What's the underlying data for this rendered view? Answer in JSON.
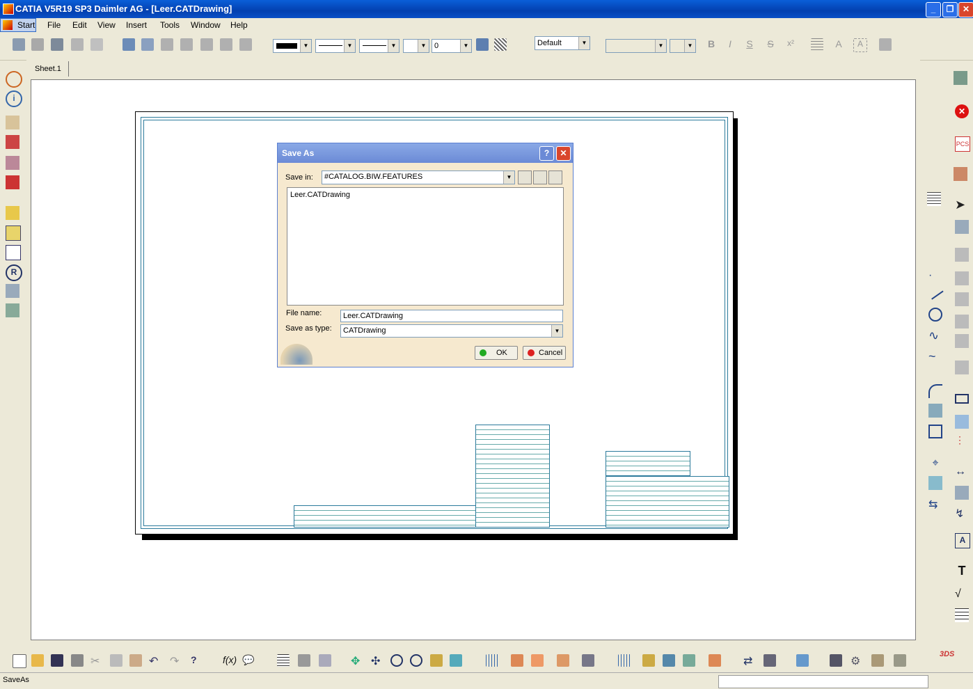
{
  "window": {
    "title": "CATIA V5R19 SP3 Daimler AG - [Leer.CATDrawing]",
    "min": "_",
    "max": "❐",
    "close": "✕"
  },
  "menu": [
    "Start",
    "File",
    "Edit",
    "View",
    "Insert",
    "Tools",
    "Window",
    "Help"
  ],
  "toolbar": {
    "line_weight_value": "0",
    "layer_value": "Default"
  },
  "sheet_tab": "Sheet.1",
  "dialog": {
    "title": "Save As",
    "help": "?",
    "close": "✕",
    "save_in_label": "Save in:",
    "save_in_value": "#CATALOG.BIW.FEATURES",
    "files": [
      "Leer.CATDrawing"
    ],
    "file_name_label": "File name:",
    "file_name_value": "Leer.CATDrawing",
    "save_as_type_label": "Save as type:",
    "save_as_type_value": "CATDrawing",
    "ok_label": "OK",
    "cancel_label": "Cancel"
  },
  "status": {
    "text": "SaveAs"
  },
  "colors": {
    "title_blue": "#0a4fc6",
    "frame_teal": "#2b7a9b",
    "dialog_bg": "#f6e9cf"
  }
}
